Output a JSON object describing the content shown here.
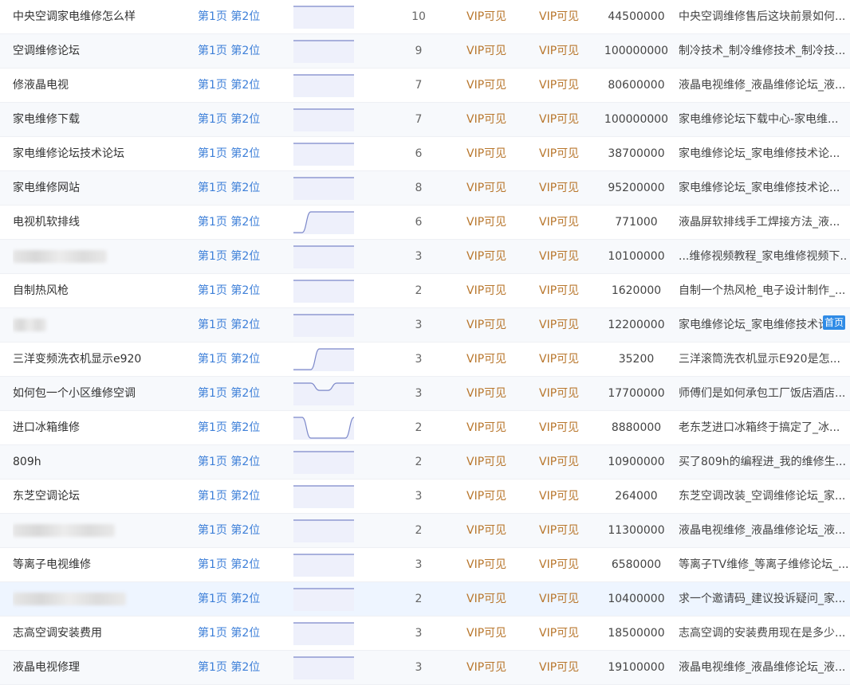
{
  "vip_label": "VIP可见",
  "home_badge": "首页",
  "rows": [
    {
      "keyword": "中央空调家电维修怎么样",
      "rank": "第1页 第2位",
      "count": "10",
      "volume": "44500000",
      "title": "中央空调维修售后这块前景如何...",
      "trend": [
        0,
        0,
        0,
        0,
        0,
        0,
        0,
        0
      ],
      "blur": 0
    },
    {
      "keyword": "空调维修论坛",
      "rank": "第1页 第2位",
      "count": "9",
      "volume": "100000000",
      "title": "制冷技术_制冷维修技术_制冷技...",
      "trend": [
        0,
        0,
        0,
        0,
        0,
        0,
        0,
        0
      ],
      "blur": 0
    },
    {
      "keyword": "修液晶电视",
      "rank": "第1页 第2位",
      "count": "7",
      "volume": "80600000",
      "title": "液晶电视维修_液晶维修论坛_液...",
      "trend": [
        0,
        0,
        0,
        0,
        0,
        0,
        0,
        0
      ],
      "blur": 0
    },
    {
      "keyword": "家电维修下载",
      "rank": "第1页 第2位",
      "count": "7",
      "volume": "100000000",
      "title": "家电维修论坛下载中心-家电维...",
      "trend": [
        0,
        0,
        0,
        0,
        0,
        0,
        0,
        0
      ],
      "blur": 0
    },
    {
      "keyword": "家电维修论坛技术论坛",
      "rank": "第1页 第2位",
      "count": "6",
      "volume": "38700000",
      "title": "家电维修论坛_家电维修技术论...",
      "trend": [
        0,
        0,
        0,
        0,
        0,
        0,
        0,
        0
      ],
      "blur": 0
    },
    {
      "keyword": "家电维修网站",
      "rank": "第1页 第2位",
      "count": "8",
      "volume": "95200000",
      "title": "家电维修论坛_家电维修技术论...",
      "trend": [
        0,
        0,
        0,
        0,
        0,
        0,
        0,
        0
      ],
      "blur": 0
    },
    {
      "keyword": "电视机软排线",
      "rank": "第1页 第2位",
      "count": "6",
      "volume": "771000",
      "title": "液晶屏软排线手工焊接方法_液...",
      "trend": [
        1,
        1,
        0,
        0,
        0,
        0,
        0,
        0
      ],
      "blur": 0
    },
    {
      "keyword": "",
      "rank": "第1页 第2位",
      "count": "3",
      "volume": "10100000",
      "title": "...维修视频教程_家电维修视频下...",
      "trend": [
        0,
        0,
        0,
        0,
        0,
        0,
        0,
        0
      ],
      "blur": 118
    },
    {
      "keyword": "自制热风枪",
      "rank": "第1页 第2位",
      "count": "2",
      "volume": "1620000",
      "title": "自制一个热风枪_电子设计制作_...",
      "trend": [
        0,
        0,
        0,
        0,
        0,
        0,
        0,
        0
      ],
      "blur": 0
    },
    {
      "keyword": "",
      "rank": "第1页 第2位",
      "count": "3",
      "volume": "12200000",
      "title": "家电维修论坛_家电维修技术论",
      "trend": [
        0,
        0,
        0,
        0,
        0,
        0,
        0,
        0
      ],
      "blur": 42
    },
    {
      "keyword": "三洋变频洗衣机显示e920",
      "rank": "第1页 第2位",
      "count": "3",
      "volume": "35200",
      "title": "三洋滚筒洗衣机显示E920是怎...",
      "trend": [
        1,
        1,
        1,
        0,
        0,
        0,
        0,
        0
      ],
      "blur": 0
    },
    {
      "keyword": "如何包一个小区维修空调",
      "rank": "第1页 第2位",
      "count": "3",
      "volume": "17700000",
      "title": "师傅们是如何承包工厂饭店酒店...",
      "trend": [
        0,
        0,
        0,
        0.35,
        0.35,
        0,
        0,
        0
      ],
      "blur": 0
    },
    {
      "keyword": "进口冰箱维修",
      "rank": "第1页 第2位",
      "count": "2",
      "volume": "8880000",
      "title": "老东芝进口冰箱终于搞定了_冰...",
      "trend": [
        0,
        0,
        1,
        1,
        1,
        1,
        1,
        0
      ],
      "blur": 0
    },
    {
      "keyword": "809h",
      "rank": "第1页 第2位",
      "count": "2",
      "volume": "10900000",
      "title": "买了809h的编程进_我的维修生...",
      "trend": [
        0,
        0,
        0,
        0,
        0,
        0,
        0,
        0
      ],
      "blur": 0
    },
    {
      "keyword": "东芝空调论坛",
      "rank": "第1页 第2位",
      "count": "3",
      "volume": "264000",
      "title": "东芝空调改装_空调维修论坛_家...",
      "trend": [
        0,
        0,
        0,
        0,
        0,
        0,
        0,
        0
      ],
      "blur": 0
    },
    {
      "keyword": "",
      "rank": "第1页 第2位",
      "count": "2",
      "volume": "11300000",
      "title": "液晶电视维修_液晶维修论坛_液...",
      "trend": [
        0,
        0,
        0,
        0,
        0,
        0,
        0,
        0
      ],
      "blur": 128
    },
    {
      "keyword": "等离子电视维修",
      "rank": "第1页 第2位",
      "count": "3",
      "volume": "6580000",
      "title": "等离子TV维修_等离子维修论坛_...",
      "trend": [
        0,
        0,
        0,
        0,
        0,
        0,
        0,
        0
      ],
      "blur": 0
    },
    {
      "keyword": "",
      "rank": "第1页 第2位",
      "count": "2",
      "volume": "10400000",
      "title": "求一个邀请码_建议投诉疑问_家...",
      "trend": [
        0,
        0,
        0,
        0,
        0,
        0,
        0,
        0
      ],
      "blur": 142
    },
    {
      "keyword": "志高空调安装费用",
      "rank": "第1页 第2位",
      "count": "3",
      "volume": "18500000",
      "title": "志高空调的安装费用现在是多少...",
      "trend": [
        0,
        0,
        0,
        0,
        0,
        0,
        0,
        0
      ],
      "blur": 0
    },
    {
      "keyword": "液晶电视修理",
      "rank": "第1页 第2位",
      "count": "3",
      "volume": "19100000",
      "title": "液晶电视维修_液晶维修论坛_液...",
      "trend": [
        0,
        0,
        0,
        0,
        0,
        0,
        0,
        0
      ],
      "blur": 0
    }
  ],
  "colors": {
    "rank_link": "#3d7fd8",
    "vip": "#b8762c",
    "trend_line": "#7b87c9",
    "trend_fill": "#eef0fb",
    "badge": "#2f8be6"
  }
}
